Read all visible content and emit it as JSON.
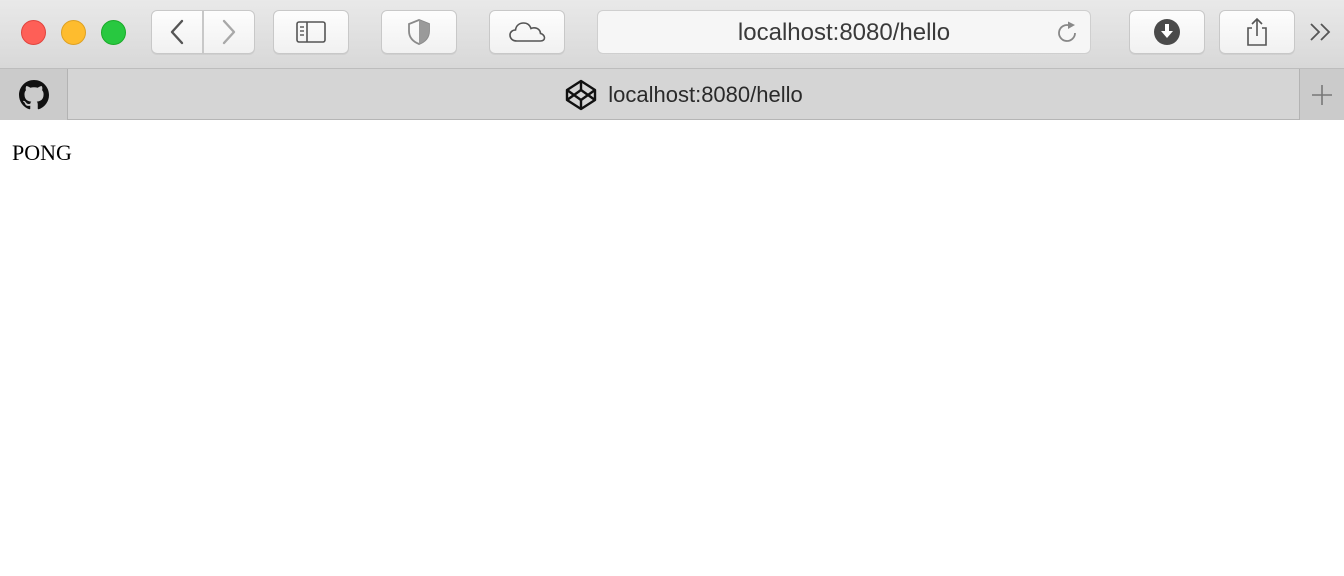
{
  "browser": {
    "address_bar": {
      "url": "localhost:8080/hello"
    },
    "toolbar_icons": [
      "back-icon",
      "forward-icon",
      "sidebar-icon",
      "shield-icon",
      "cloud-icon",
      "reload-icon",
      "download-icon",
      "share-icon",
      "overflow-chevron-icon"
    ]
  },
  "tabs": {
    "pinned_icon": "github-icon",
    "active_tab": {
      "title": "localhost:8080/hello",
      "favicon": "codepen-icon"
    },
    "new_tab_icon": "plus-icon"
  },
  "page": {
    "text": "PONG"
  },
  "colors": {
    "close": "#fe5f57",
    "minimize": "#febc2e",
    "zoom": "#28c840"
  }
}
